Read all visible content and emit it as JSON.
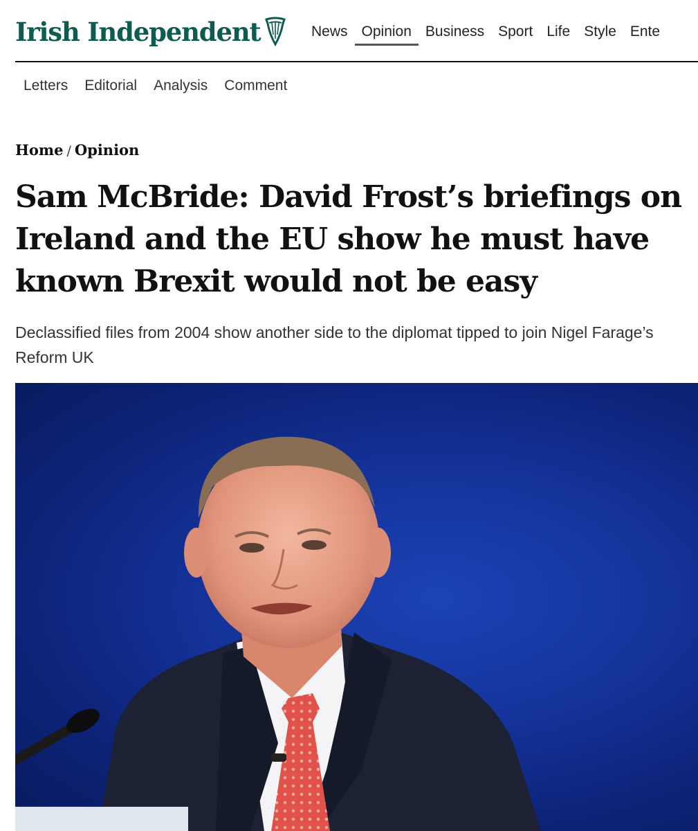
{
  "site": {
    "name": "Irish Independent",
    "logo_icon": "harp-icon",
    "brand_color": "#0e5c4f"
  },
  "topnav": {
    "items": [
      {
        "label": "News"
      },
      {
        "label": "Opinion",
        "active": true
      },
      {
        "label": "Business"
      },
      {
        "label": "Sport"
      },
      {
        "label": "Life"
      },
      {
        "label": "Style"
      },
      {
        "label": "Ente"
      }
    ]
  },
  "subnav": {
    "items": [
      {
        "label": "Letters"
      },
      {
        "label": "Editorial"
      },
      {
        "label": "Analysis"
      },
      {
        "label": "Comment"
      }
    ]
  },
  "breadcrumb": {
    "home": "Home",
    "separator": "/",
    "section": "Opinion"
  },
  "article": {
    "headline": "Sam McBride: David Frost’s briefings on Ireland and the EU show he must have known Brexit would not be easy",
    "standfirst": "Declassified files from 2004 show another side to the diplomat tipped to join Nigel Farage’s Reform UK",
    "image": {
      "subject": "man in dark suit, white shirt and red patterned tie speaking at a lectern microphone",
      "background_color": "#14339a"
    }
  }
}
